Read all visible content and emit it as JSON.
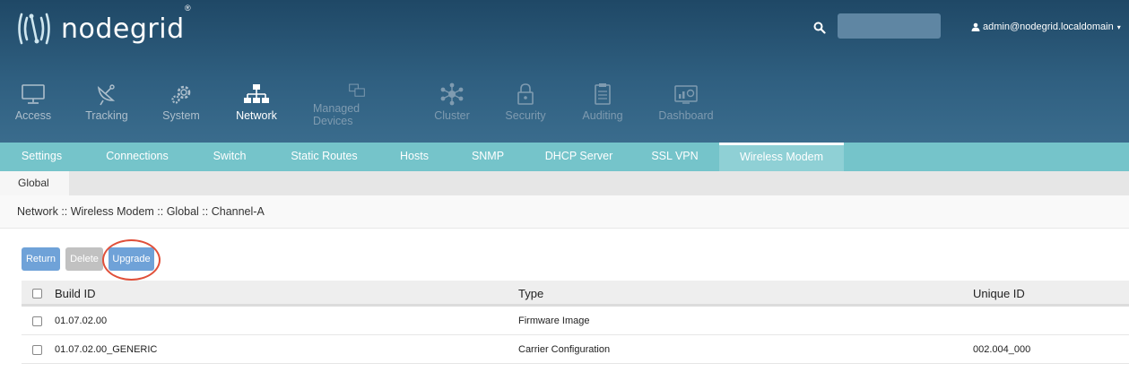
{
  "brand": {
    "name": "nodegrid",
    "registered": "®"
  },
  "search": {
    "placeholder": ""
  },
  "user": {
    "label": "admin@nodegrid.localdomain",
    "caret": "▾"
  },
  "nav": [
    {
      "label": "Access",
      "icon": "monitor-icon"
    },
    {
      "label": "Tracking",
      "icon": "satellite-dish-icon"
    },
    {
      "label": "System",
      "icon": "gears-icon"
    },
    {
      "label": "Network",
      "icon": "network-tree-icon",
      "active": true
    },
    {
      "label": "Managed Devices",
      "icon": "devices-icon"
    },
    {
      "label": "Cluster",
      "icon": "cluster-icon"
    },
    {
      "label": "Security",
      "icon": "lock-icon"
    },
    {
      "label": "Auditing",
      "icon": "clipboard-icon"
    },
    {
      "label": "Dashboard",
      "icon": "dashboard-icon"
    }
  ],
  "subnav": [
    {
      "label": "Settings"
    },
    {
      "label": "Connections"
    },
    {
      "label": "Switch"
    },
    {
      "label": "Static Routes"
    },
    {
      "label": "Hosts"
    },
    {
      "label": "SNMP"
    },
    {
      "label": "DHCP Server"
    },
    {
      "label": "SSL VPN"
    },
    {
      "label": "Wireless Modem",
      "active": true
    }
  ],
  "tabs": [
    {
      "label": "Global",
      "active": true
    }
  ],
  "breadcrumb": "Network :: Wireless Modem :: Global :: Channel-A",
  "toolbar": {
    "return_label": "Return",
    "delete_label": "Delete",
    "upgrade_label": "Upgrade"
  },
  "table": {
    "columns": [
      "Build ID",
      "Type",
      "Unique ID"
    ],
    "rows": [
      {
        "build_id": "01.07.02.00",
        "type": "Firmware Image",
        "unique_id": ""
      },
      {
        "build_id": "01.07.02.00_GENERIC",
        "type": "Carrier Configuration",
        "unique_id": "002.004_000"
      }
    ]
  },
  "colors": {
    "header": "#2f5f80",
    "subnav": "#75c4ca",
    "button_primary": "#6fa2d8",
    "button_disabled": "#c1c1c1",
    "highlight": "#e0503a"
  }
}
